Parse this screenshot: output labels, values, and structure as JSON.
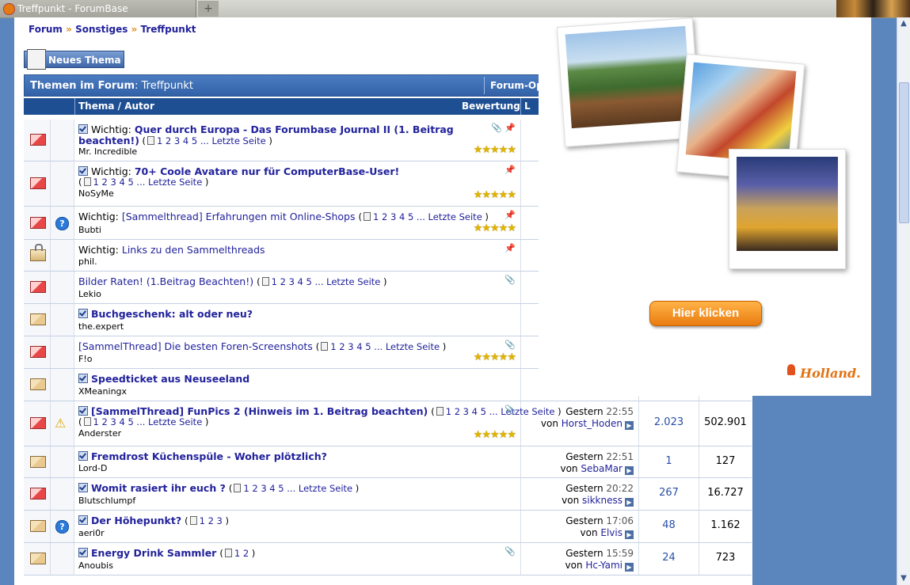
{
  "browser": {
    "tab_title": "Treffpunkt - ForumBase",
    "new_tab_symbol": "+"
  },
  "breadcrumb": {
    "items": [
      "Forum",
      "Sonstiges",
      "Treffpunkt"
    ],
    "separator": "»"
  },
  "new_thread_button": "Neues Thema",
  "table_header": {
    "prefix": "Themen im Forum",
    "forum_name": ": Treffpunkt",
    "forum_options": "Forum-Op",
    "col_topic": "Thema / Autor",
    "col_rating": "Bewertung",
    "col_last": "L"
  },
  "threads": [
    {
      "prefix": "Wichtig: ",
      "title": "Quer durch Europa - Das Forumbase Journal II (1. Beitrag",
      "title2": "beachten!)",
      "pages": [
        "1",
        "2",
        "3",
        "4",
        "5",
        "...",
        "Letzte Seite"
      ],
      "author": "Mr. Incredible",
      "bold": true,
      "checked": true,
      "stars": "★★★★★",
      "attach": "📎",
      "pin": "📌"
    },
    {
      "prefix": "Wichtig: ",
      "title": "70+ Coole Avatare nur für ComputerBase-User!",
      "pages": [
        "1",
        "2",
        "3",
        "4",
        "5",
        "...",
        "Letzte Seite"
      ],
      "author": "NoSyMe",
      "bold": true,
      "checked": true,
      "stars": "★★★★★",
      "pin": "📌"
    },
    {
      "prefix": "Wichtig: ",
      "title": "[Sammelthread] Erfahrungen mit Online-Shops",
      "pages": [
        "1",
        "2",
        "3",
        "4",
        "5",
        "...",
        "Letzte Seite"
      ],
      "author": "Bubti",
      "stars": "★★★★★",
      "pin": "📌",
      "question": "?"
    },
    {
      "prefix": "Wichtig: ",
      "title": "Links zu den Sammelthreads",
      "author": "phil.",
      "pin": "📌"
    },
    {
      "title": "Bilder Raten! (1.Beitrag Beachten!)",
      "pages": [
        "1",
        "2",
        "3",
        "4",
        "5",
        "...",
        "Letzte Seite"
      ],
      "author": "Lekio",
      "attach": "📎"
    },
    {
      "title": "Buchgeschenk: alt oder neu?",
      "author": "the.expert",
      "bold": true,
      "checked": true
    },
    {
      "title": "[SammelThread] Die besten Foren-Screenshots",
      "pages": [
        "1",
        "2",
        "3",
        "4",
        "5",
        "...",
        "Letzte Seite"
      ],
      "author": "F!o",
      "stars": "★★★★★",
      "attach": "📎"
    },
    {
      "title": "Speedticket aus Neuseeland",
      "author": "XMeaningx",
      "bold": true,
      "checked": true
    },
    {
      "title": "[SammelThread] FunPics 2 (Hinweis im 1. Beitrag beachten)",
      "pages": [
        "1",
        "2",
        "3",
        "4",
        "5",
        "...",
        "Letzte Seite"
      ],
      "author": "Anderster",
      "bold": true,
      "checked": true,
      "stars": "★★★★★",
      "attach": "📎",
      "warn": "⚠",
      "last_day": "Gestern",
      "last_time": "22:55",
      "last_by": "von",
      "last_user": "Horst_Hoden",
      "replies": "2.023",
      "views": "502.901"
    },
    {
      "title": "Fremdrost Küchenspüle - Woher plötzlich?",
      "author": "Lord-D",
      "bold": true,
      "checked": true,
      "last_day": "Gestern",
      "last_time": "22:51",
      "last_by": "von",
      "last_user": "SebaMar",
      "replies": "1",
      "views": "127"
    },
    {
      "title": "Womit rasiert ihr euch ?",
      "pages": [
        "1",
        "2",
        "3",
        "4",
        "5",
        "...",
        "Letzte Seite"
      ],
      "author": "Blutschlumpf",
      "bold": true,
      "checked": true,
      "last_day": "Gestern",
      "last_time": "20:22",
      "last_by": "von",
      "last_user": "sikkness",
      "replies": "267",
      "views": "16.727"
    },
    {
      "title": "Der Höhepunkt?",
      "pages": [
        "1",
        "2",
        "3"
      ],
      "author": "aeri0r",
      "bold": true,
      "checked": true,
      "question": "?",
      "last_day": "Gestern",
      "last_time": "17:06",
      "last_by": "von",
      "last_user": "Elvis",
      "replies": "48",
      "views": "1.162"
    },
    {
      "title": "Energy Drink Sammler",
      "pages": [
        "1",
        "2"
      ],
      "author": "Anoubis",
      "bold": true,
      "checked": true,
      "attach": "📎",
      "last_day": "Gestern",
      "last_time": "15:59",
      "last_by": "von",
      "last_user": "Hc-Yami",
      "replies": "24",
      "views": "723"
    }
  ],
  "ad": {
    "button": "Hier klicken",
    "logo": "Holland."
  },
  "colors": {
    "accent": "#3261a8",
    "link": "#22229c",
    "ad_button": "#e97c10"
  }
}
